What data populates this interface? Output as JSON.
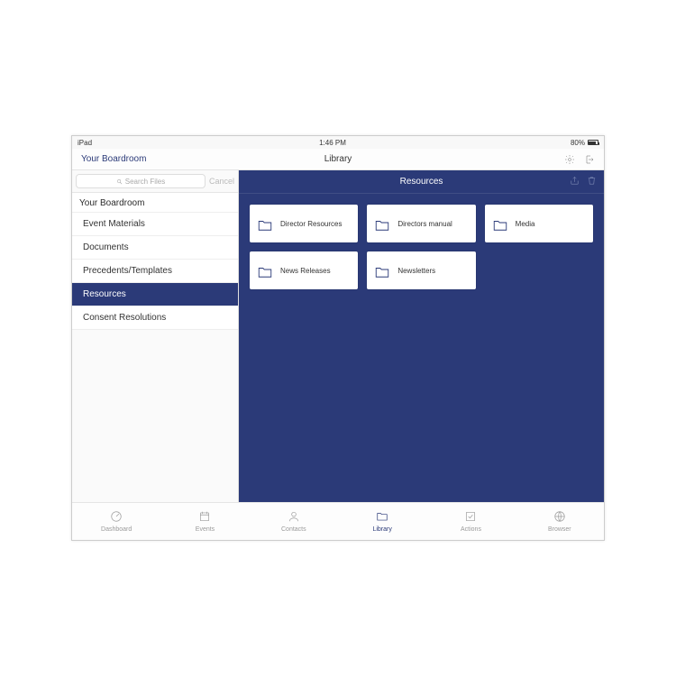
{
  "statusbar": {
    "carrier": "iPad",
    "time": "1:46 PM",
    "battery": "80%"
  },
  "navbar": {
    "left": "Your Boardroom",
    "title": "Library"
  },
  "search": {
    "placeholder": "Search Files",
    "cancel": "Cancel"
  },
  "sidebar": {
    "header": "Your Boardroom",
    "items": [
      {
        "label": "Event Materials"
      },
      {
        "label": "Documents"
      },
      {
        "label": "Precedents/Templates"
      },
      {
        "label": "Resources"
      },
      {
        "label": "Consent Resolutions"
      }
    ],
    "activeIndex": 3
  },
  "main": {
    "title": "Resources"
  },
  "folders": [
    {
      "label": "Director Resources"
    },
    {
      "label": "Directors manual"
    },
    {
      "label": "Media"
    },
    {
      "label": "News Releases"
    },
    {
      "label": "Newsletters"
    }
  ],
  "tabs": [
    {
      "label": "Dashboard",
      "icon": "gauge"
    },
    {
      "label": "Events",
      "icon": "calendar"
    },
    {
      "label": "Contacts",
      "icon": "person"
    },
    {
      "label": "Library",
      "icon": "folder"
    },
    {
      "label": "Actions",
      "icon": "checkbox"
    },
    {
      "label": "Browser",
      "icon": "globe"
    }
  ],
  "activeTab": 3
}
